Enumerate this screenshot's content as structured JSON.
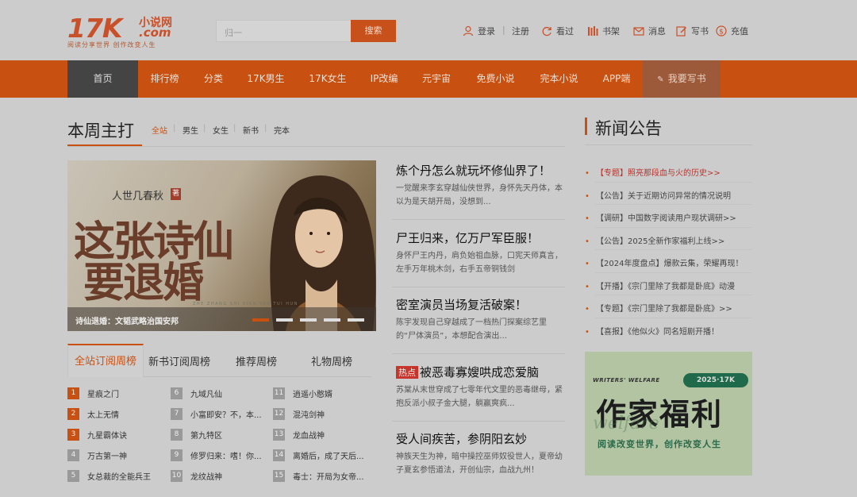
{
  "header": {
    "logo_main": "17K",
    "logo_cn": "小说网",
    "logo_com": ".com",
    "logo_slogan": "阅读分享世界  创作改变人生",
    "search_placeholder": "归一",
    "search_button": "搜索",
    "login": "登录",
    "register": "注册",
    "history": "看过",
    "bookshelf": "书架",
    "messages": "消息",
    "write": "写书",
    "recharge": "充值"
  },
  "nav": {
    "items": [
      "首页",
      "排行榜",
      "分类",
      "17K男生",
      "17K女生",
      "IP改编",
      "元宇宙",
      "免费小说",
      "完本小说",
      "APP端"
    ],
    "write_label": "我要写书"
  },
  "weekly": {
    "title": "本周主打",
    "filters": [
      "全站",
      "男生",
      "女生",
      "新书",
      "完本"
    ]
  },
  "banner": {
    "author": "人世几春秋",
    "zhu": "著",
    "title_line1": "这张诗仙",
    "title_line2": "要退婚",
    "pinyin": "ZHE ZHANG SHI XIAN YAO TUI HUN",
    "caption": "诗仙退婚：文韬武略治国安邦"
  },
  "news": [
    {
      "title": "炼个丹怎么就玩坏修仙界了！",
      "desc": "一觉醒来李玄穿越仙侠世界，身怀先天丹体，本以为是天胡开局，没想到..."
    },
    {
      "title": "尸王归来，亿万尸军臣服！",
      "desc": "身怀尸王内丹，肩负始祖血脉，口宪天师真言，左手万年桃木剑，右手五帝铜钱剑"
    },
    {
      "title": "密室演员当场复活破案！",
      "desc": "陈宇发现自己穿越成了一档热门探案综艺里的“尸体演员”，本想配合演出..."
    },
    {
      "hot": "热点",
      "title": "被恶毒寡嫂哄成恋爱脑",
      "desc": "苏棠从末世穿成了七零年代文里的恶毒继母，紧抱反派小叔子金大腿，躺赢爽疯..."
    },
    {
      "title": "受人间疾苦，参阴阳玄妙",
      "desc": "神族天生为神，暗中操控巫师奴役世人，夏帝幼子夏玄参悟道法，开创仙宗，血战九州！"
    }
  ],
  "tabs": [
    "全站订阅周榜",
    "新书订阅周榜",
    "推荐周榜",
    "礼物周榜"
  ],
  "ranking": [
    {
      "num": "1",
      "name": "星痕之门"
    },
    {
      "num": "2",
      "name": "太上无情"
    },
    {
      "num": "3",
      "name": "九星霸体诀"
    },
    {
      "num": "4",
      "name": "万古第一神"
    },
    {
      "num": "5",
      "name": "女总裁的全能兵王"
    },
    {
      "num": "6",
      "name": "九域凡仙"
    },
    {
      "num": "7",
      "name": "小富即安？不，本..."
    },
    {
      "num": "8",
      "name": "第九特区"
    },
    {
      "num": "9",
      "name": "修罗归来：嗜！你..."
    },
    {
      "num": "10",
      "name": "龙纹战神"
    },
    {
      "num": "11",
      "name": "逍遥小憨婿"
    },
    {
      "num": "12",
      "name": "混沌剑神"
    },
    {
      "num": "13",
      "name": "龙血战神"
    },
    {
      "num": "14",
      "name": "离婚后，成了天后..."
    },
    {
      "num": "15",
      "name": "毒士：开局为女帝..."
    }
  ],
  "announcements": {
    "title": "新闻公告",
    "items": [
      {
        "text": "【专题】照亮那段血与火的历史>>",
        "red": true
      },
      {
        "text": "【公告】关于近期访问异常的情况说明",
        "red": false
      },
      {
        "text": "【调研】中国数字阅读用户现状调研>>",
        "red": false
      },
      {
        "text": "【公告】2025全新作家福利上线>>",
        "red": false
      },
      {
        "text": "【2024年度盘点】爆款云集，荣耀再现！",
        "red": false
      },
      {
        "text": "【开播】《宗门里除了我都是卧底》动漫",
        "red": false
      },
      {
        "text": "【专题】《宗门里除了我都是卧底》>>",
        "red": false
      },
      {
        "text": "【喜报】《他似火》同名短剧开播！",
        "red": false
      }
    ]
  },
  "promo": {
    "tag": "WRITERS' WELFARE",
    "badge": "2025·17K",
    "big": "作家福利",
    "script": "welfare",
    "sub": "阅读改变世界，创作改变人生"
  },
  "colors": {
    "accent": "#c85112",
    "background": "#cccccc"
  }
}
